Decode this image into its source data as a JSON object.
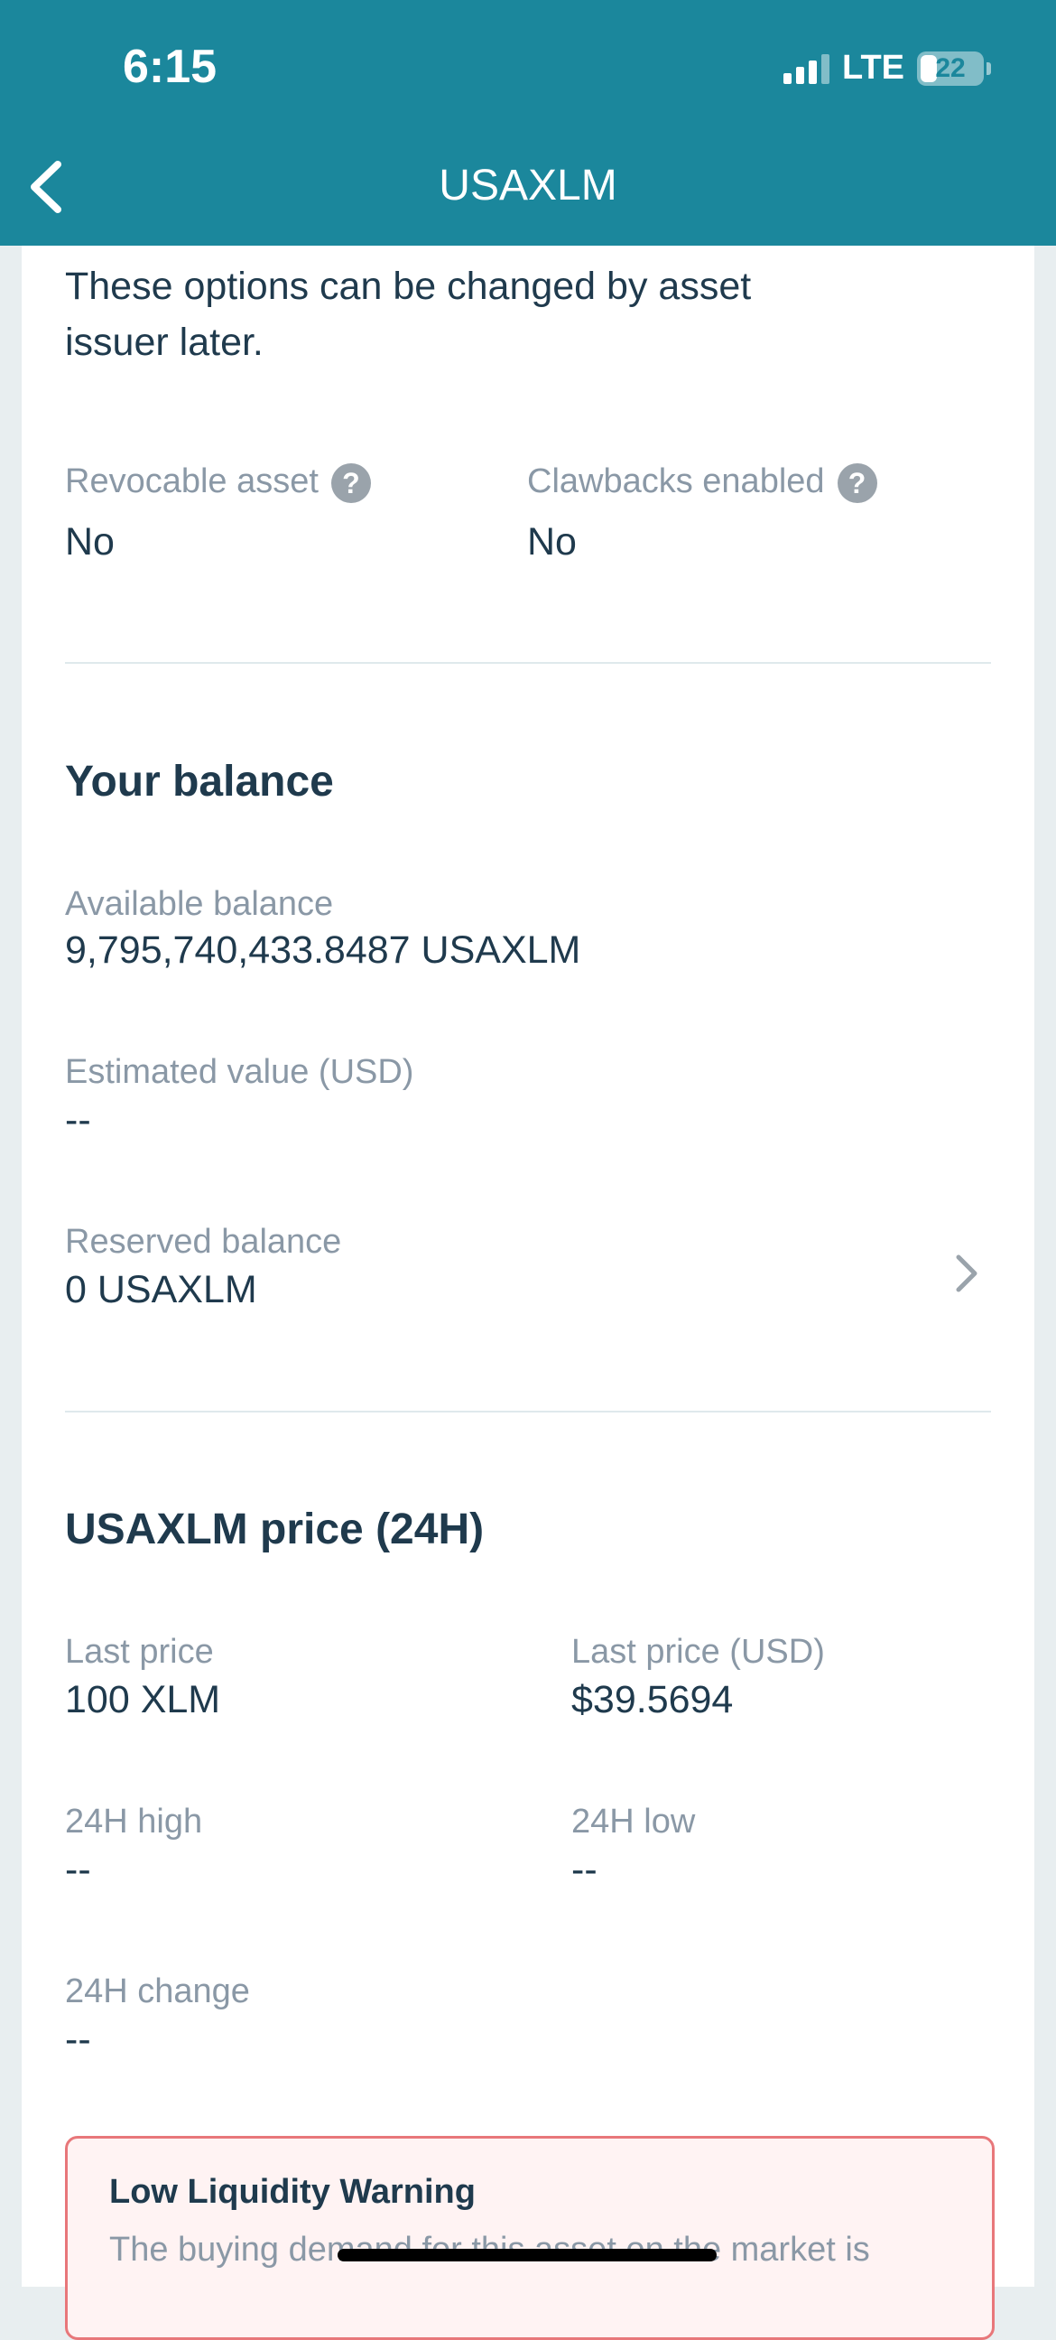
{
  "status_bar": {
    "time": "6:15",
    "network": "LTE",
    "battery": "22"
  },
  "nav": {
    "title": "USAXLM"
  },
  "flags": {
    "intro": "These options can be changed by asset issuer later.",
    "revocable_label": "Revocable asset",
    "revocable_value": "No",
    "clawback_label": "Clawbacks enabled",
    "clawback_value": "No",
    "help_glyph": "?"
  },
  "balance": {
    "title": "Your balance",
    "available_label": "Available balance",
    "available_value": "9,795,740,433.8487 USAXLM",
    "estimated_label": "Estimated value (USD)",
    "estimated_value": "--",
    "reserved_label": "Reserved balance",
    "reserved_value": "0 USAXLM"
  },
  "price": {
    "title": "USAXLM price (24H)",
    "last_price_label": "Last price",
    "last_price_value": "100 XLM",
    "last_price_usd_label": "Last price (USD)",
    "last_price_usd_value": "$39.5694",
    "high_label": "24H high",
    "high_value": "--",
    "low_label": "24H low",
    "low_value": "--",
    "change_label": "24H change",
    "change_value": "--"
  },
  "warning": {
    "title": "Low Liquidity Warning",
    "text": "The buying demand for this asset on the market is"
  },
  "colors": {
    "header": "#1b879c",
    "warning_border": "#e8777a"
  },
  "icons": [
    "back-chevron-icon",
    "help-icon",
    "chevron-right-icon",
    "signal-icon",
    "battery-icon"
  ]
}
